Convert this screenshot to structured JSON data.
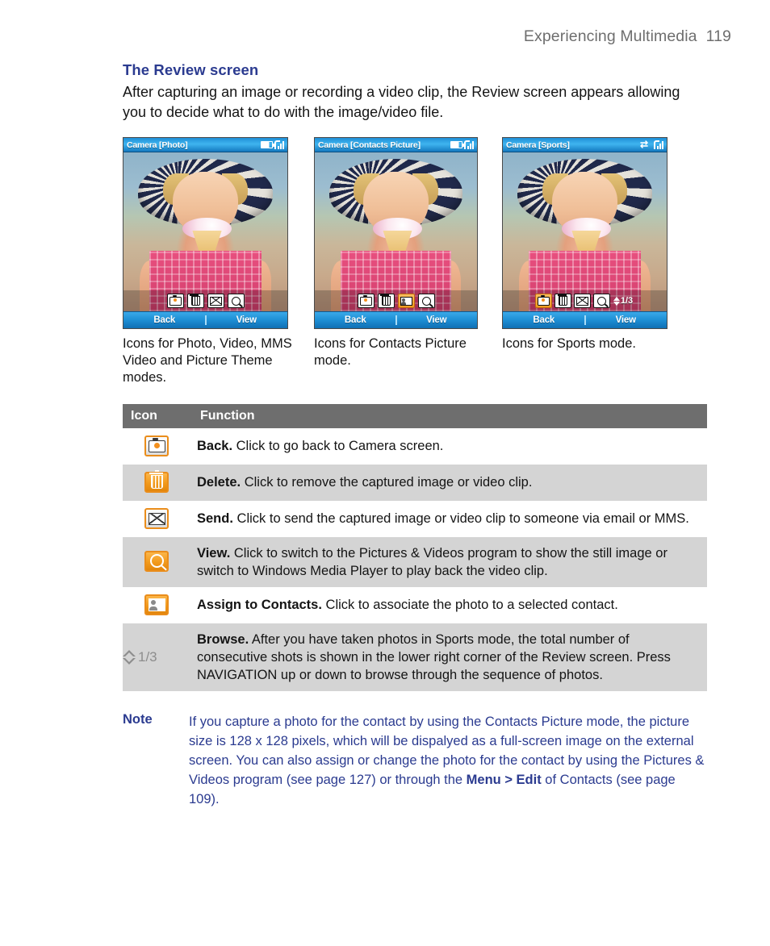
{
  "header": {
    "chapter": "Experiencing Multimedia",
    "page_number": "119"
  },
  "section": {
    "title": "The Review screen",
    "intro": "After capturing an image or recording a video clip, the Review screen appears allowing you to decide what to do with the image/video file."
  },
  "screenshots": [
    {
      "titlebar": "Camera [Photo]",
      "status_icons": [
        "battery-icon",
        "signal-icon"
      ],
      "toolbar_icons": [
        "camera-icon",
        "trash-icon",
        "envelope-icon",
        "magnifier-icon"
      ],
      "softkey_left": "Back",
      "softkey_right": "View",
      "caption": "Icons for Photo, Video, MMS Video and Picture Theme modes."
    },
    {
      "titlebar": "Camera [Contacts Picture]",
      "status_icons": [
        "battery-icon",
        "signal-icon"
      ],
      "toolbar_icons": [
        "camera-icon",
        "trash-icon",
        "assign-to-contacts-icon",
        "magnifier-icon"
      ],
      "softkey_left": "Back",
      "softkey_right": "View",
      "caption": "Icons for Contacts Picture mode."
    },
    {
      "titlebar": "Camera [Sports]",
      "status_icons": [
        "sync-icon",
        "signal-icon"
      ],
      "toolbar_icons": [
        "camera-icon",
        "trash-icon",
        "envelope-icon",
        "magnifier-icon",
        "browse-icon"
      ],
      "browse_counter": "1/3",
      "softkey_left": "Back",
      "softkey_right": "View",
      "caption": "Icons for Sports mode."
    }
  ],
  "table": {
    "headers": {
      "icon": "Icon",
      "function": "Function"
    },
    "rows": [
      {
        "icon": "camera-icon",
        "term": "Back.",
        "text": " Click to go back to Camera screen."
      },
      {
        "icon": "trash-icon",
        "term": "Delete.",
        "text": " Click to remove the captured image or video clip."
      },
      {
        "icon": "envelope-icon",
        "term": "Send.",
        "text": " Click to send the captured image or video clip to someone via email or MMS."
      },
      {
        "icon": "magnifier-icon",
        "term": "View.",
        "text": " Click to switch to the Pictures & Videos program to show the still image or switch to Windows Media Player to play back the video clip."
      },
      {
        "icon": "assign-to-contacts-icon",
        "term": "Assign to Contacts.",
        "text": " Click to associate the photo to a selected contact."
      },
      {
        "icon": "browse-icon",
        "icon_label": "1/3",
        "term": "Browse.",
        "text": " After you have taken photos in Sports mode, the total number of consecutive shots is shown in the lower right corner of the Review screen. Press NAVIGATION up or down to browse through the sequence of photos."
      }
    ]
  },
  "note": {
    "label": "Note",
    "text_1": "If you capture a photo for the contact by using the Contacts Picture mode, the picture size is 128 x 128 pixels, which will be dispalyed as a full-screen image on the external screen. You can also assign or change the photo for the contact by using the Pictures & Videos program (see page 127) or through the ",
    "emphasis": "Menu > Edit",
    "text_2": " of Contacts (see page 109)."
  },
  "colors": {
    "heading_blue": "#2b3b90",
    "table_header_gray": "#6e6e6e",
    "table_alt_row": "#d4d4d4",
    "icon_orange": "#ea8d1b",
    "titlebar_blue": "#1f8fd8"
  }
}
